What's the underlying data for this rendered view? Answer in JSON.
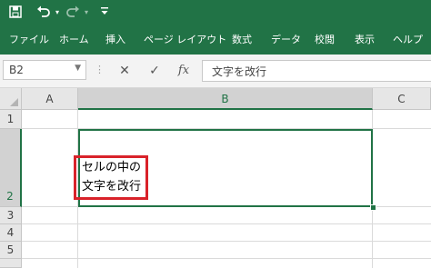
{
  "quick_access": {
    "save_icon": "save-icon",
    "undo_icon": "undo-icon",
    "redo_icon": "redo-icon",
    "customize_icon": "customize-icon"
  },
  "ribbon": {
    "tabs": [
      "ファイル",
      "ホーム",
      "挿入",
      "ページ レイアウト",
      "数式",
      "データ",
      "校閲",
      "表示",
      "ヘルプ"
    ]
  },
  "formula_bar": {
    "name_box": "B2",
    "cancel_symbol": "✕",
    "enter_symbol": "✓",
    "fx_symbol": "fx",
    "content": "文字を改行"
  },
  "sheet": {
    "columns": [
      "A",
      "B",
      "C"
    ],
    "rows": [
      "1",
      "2",
      "3",
      "4",
      "5"
    ],
    "selected_cell": "B2",
    "b2_lines": [
      "セルの中の",
      "文字を改行"
    ]
  },
  "colors": {
    "ribbon": "#217346",
    "selection": "#217346",
    "highlight_box": "#d9222a"
  }
}
